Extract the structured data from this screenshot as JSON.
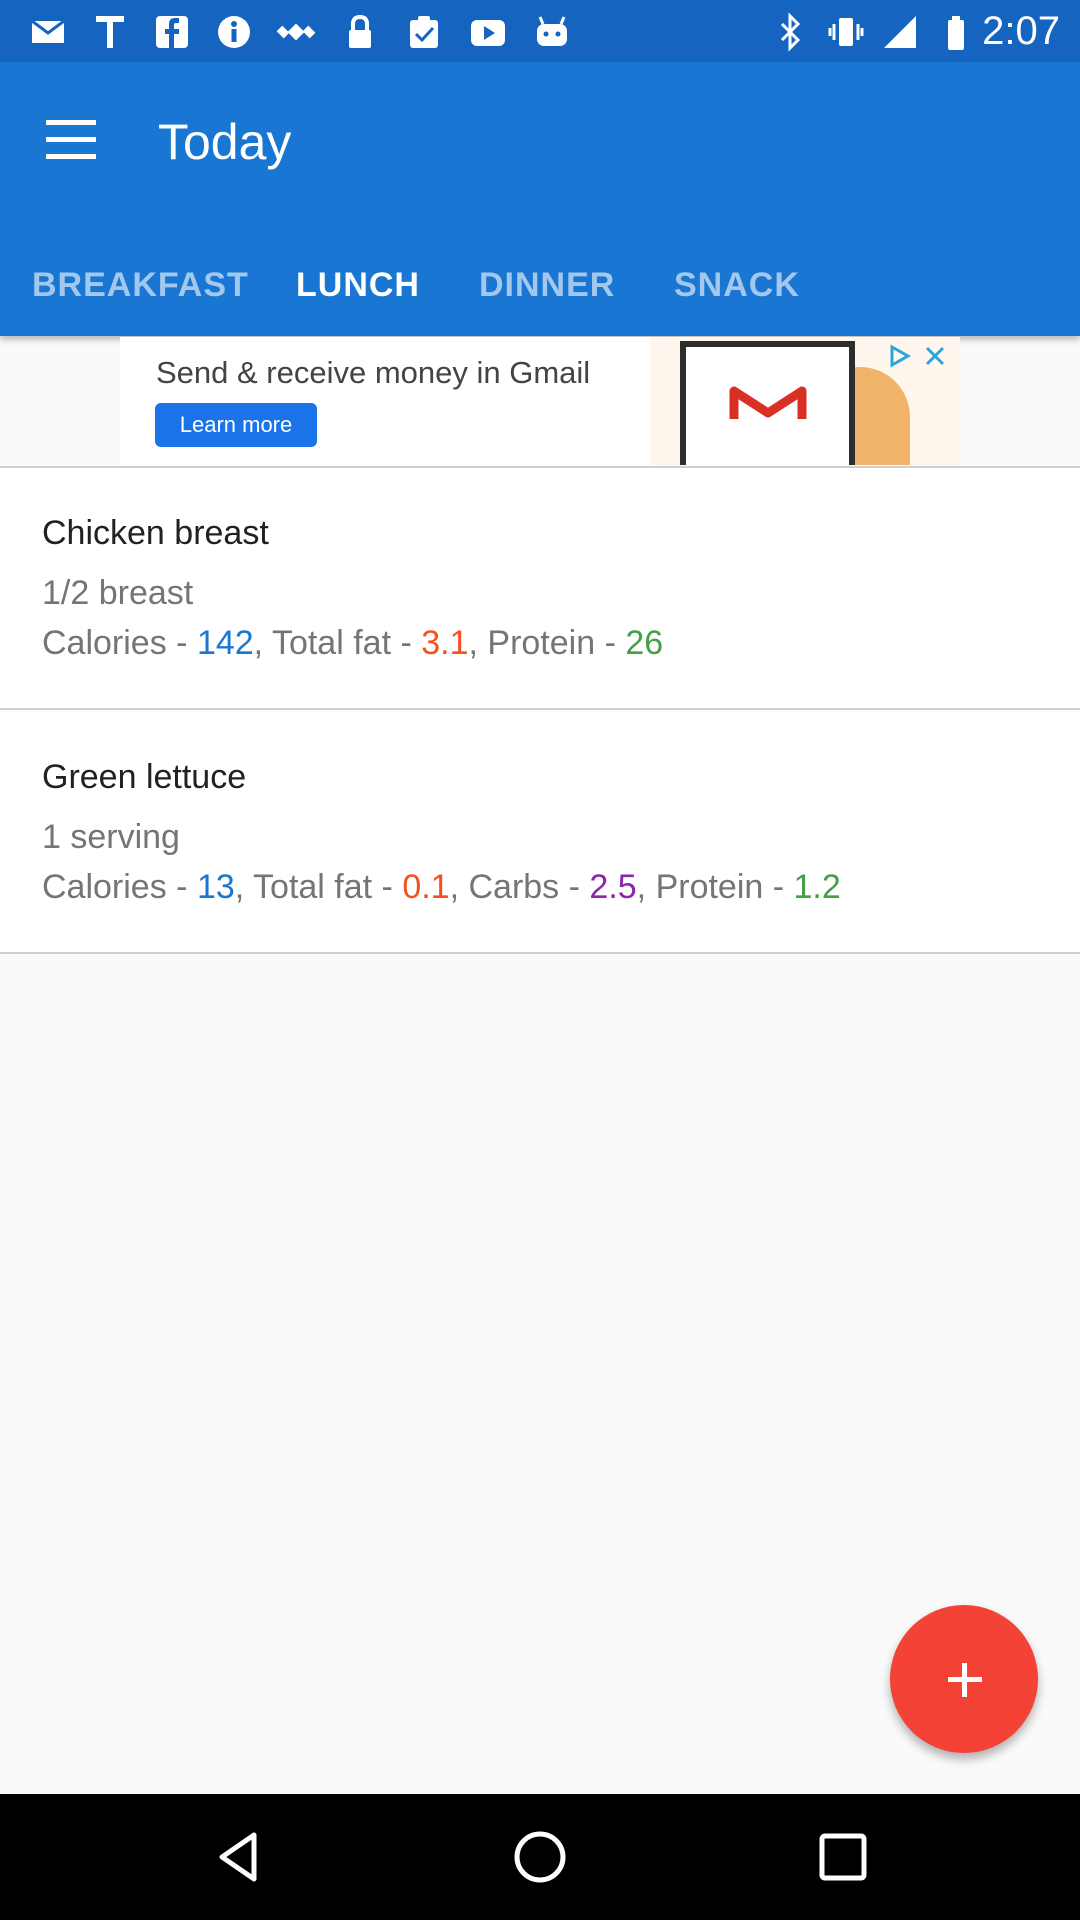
{
  "status_bar": {
    "time": "2:07",
    "icons": [
      "email-notification-icon",
      "t-icon",
      "facebook-icon",
      "info-icon",
      "satellite-icon",
      "lock-icon",
      "clipboard-icon",
      "youtube-icon",
      "android-icon",
      "bluetooth-icon"
    ]
  },
  "app_bar": {
    "title": "Today",
    "menu_icon": "hamburger-menu-icon"
  },
  "tabs": [
    {
      "label": "BREAKFAST",
      "active": false
    },
    {
      "label": "LUNCH",
      "active": true
    },
    {
      "label": "DINNER",
      "active": false
    },
    {
      "label": "SNACK",
      "active": false
    }
  ],
  "ad": {
    "headline": "Send & receive money in Gmail",
    "button_label": "Learn more",
    "logo_letter": "M"
  },
  "items": [
    {
      "name": "Chicken breast",
      "serving": "1/2 breast",
      "calories_label": "Calories - ",
      "calories": "142",
      "fat_label": ", Total fat - ",
      "fat": "3.1",
      "protein_label": ", Protein - ",
      "protein": "26"
    },
    {
      "name": "Green lettuce",
      "serving": "1 serving",
      "calories_label": "Calories - ",
      "calories": "13",
      "fat_label": ", Total fat - ",
      "fat": "0.1",
      "carbs_label": ", Carbs - ",
      "carbs": "2.5",
      "protein_label": ", Protein - ",
      "protein": "1.2"
    }
  ],
  "fab": {
    "icon": "plus-icon"
  },
  "nav_bar": {
    "icons": [
      "back-icon",
      "home-icon",
      "recents-icon"
    ]
  },
  "colors": {
    "primary": "#1976d2",
    "status_bar": "#1565c0",
    "accent": "#f44336",
    "calories": "#1976d2",
    "fat": "#f4511e",
    "carbs": "#8e24aa",
    "protein": "#43a047"
  }
}
